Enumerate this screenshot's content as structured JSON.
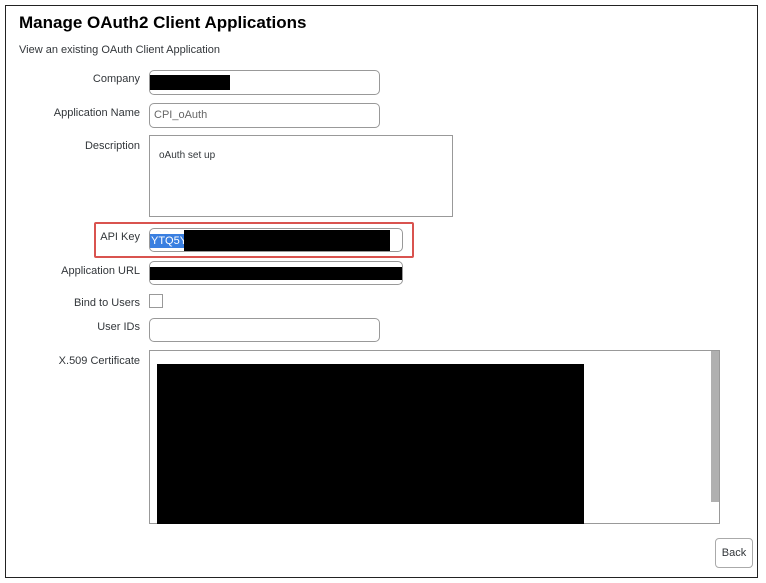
{
  "header": {
    "title": "Manage OAuth2 Client Applications",
    "subtitle": "View an existing OAuth Client Application"
  },
  "form": {
    "company": {
      "label": "Company"
    },
    "application_name": {
      "label": "Application Name",
      "value": "CPI_oAuth"
    },
    "description": {
      "label": "Description",
      "value": "oAuth set up"
    },
    "api_key": {
      "label": "API Key",
      "visible_value": "YTQ5Y"
    },
    "application_url": {
      "label": "Application URL"
    },
    "bind_to_users": {
      "label": "Bind to Users",
      "checked": false
    },
    "user_ids": {
      "label": "User IDs",
      "value": ""
    },
    "certificate": {
      "label": "X.509 Certificate"
    }
  },
  "actions": {
    "back_label": "Back"
  },
  "colors": {
    "highlight": "#d9534f",
    "selection": "#3a7fe0"
  }
}
